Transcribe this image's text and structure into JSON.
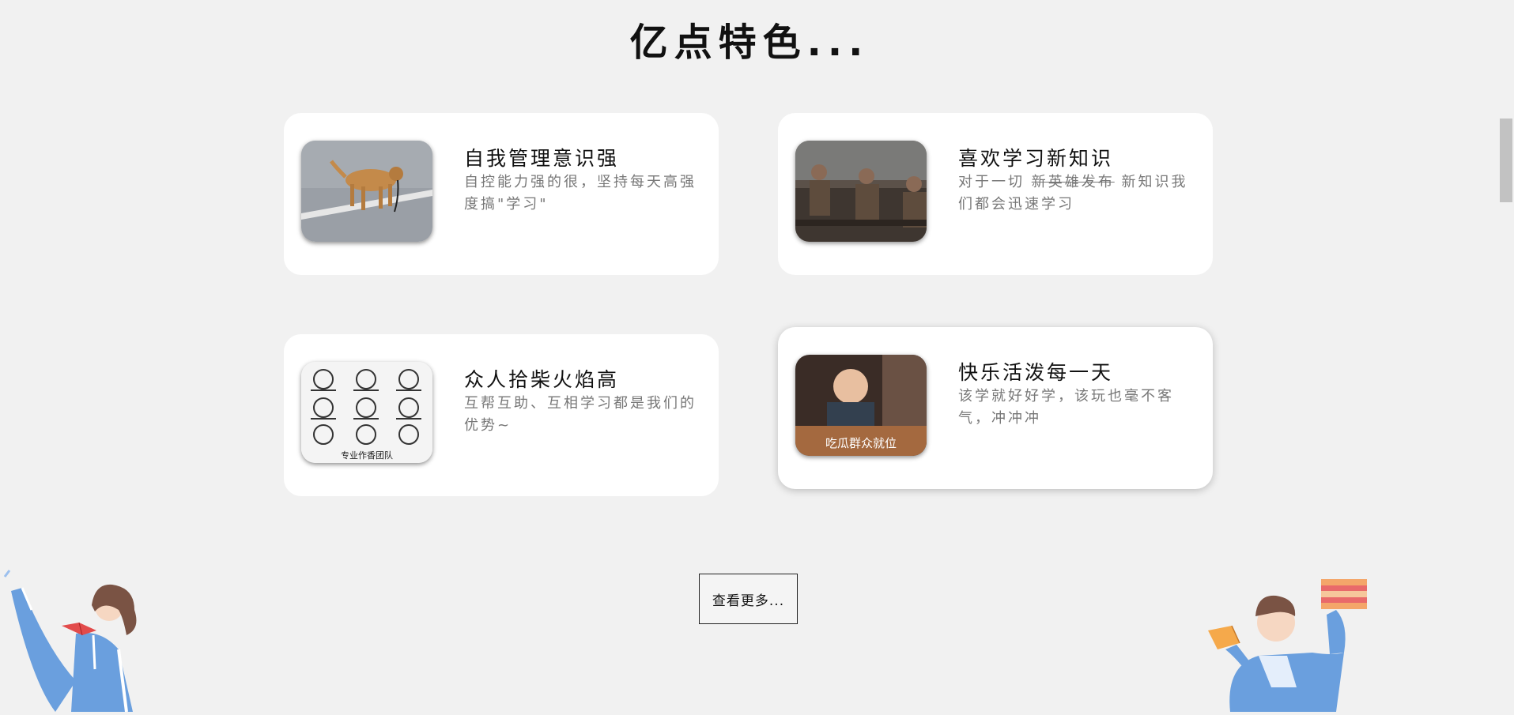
{
  "header": {
    "title": "亿点特色..."
  },
  "cards": [
    {
      "title": "自我管理意识强",
      "desc": "自控能力强的很，坚持每天高强度搞\"学习\"",
      "image": "dog-walking-itself-image"
    },
    {
      "title": "喜欢学习新知识",
      "desc_before": "对于一切 ",
      "desc_strike": "新英雄发布",
      "desc_after": " 新知识我们都会迅速学习",
      "image": "soldiers-sitting-image"
    },
    {
      "title": "众人拾柴火焰高",
      "desc": "互帮互助、互相学习都是我们的优势~",
      "image": "meme-sketch-grid-image",
      "image_caption": "专业作香团队"
    },
    {
      "title": "快乐活泼每一天",
      "desc": "该学就好好学，该玩也毫不客气，冲冲冲",
      "image": "laughing-child-image",
      "image_caption": "吃瓜群众就位"
    }
  ],
  "more_button": {
    "label": "查看更多..."
  },
  "decor": {
    "left": "student-girl-reading-illustration",
    "right": "student-boy-books-illustration"
  },
  "colors": {
    "background": "#f1f1f1",
    "card": "#ffffff",
    "desc": "#777777",
    "illustration_blue": "#6a9fde"
  }
}
